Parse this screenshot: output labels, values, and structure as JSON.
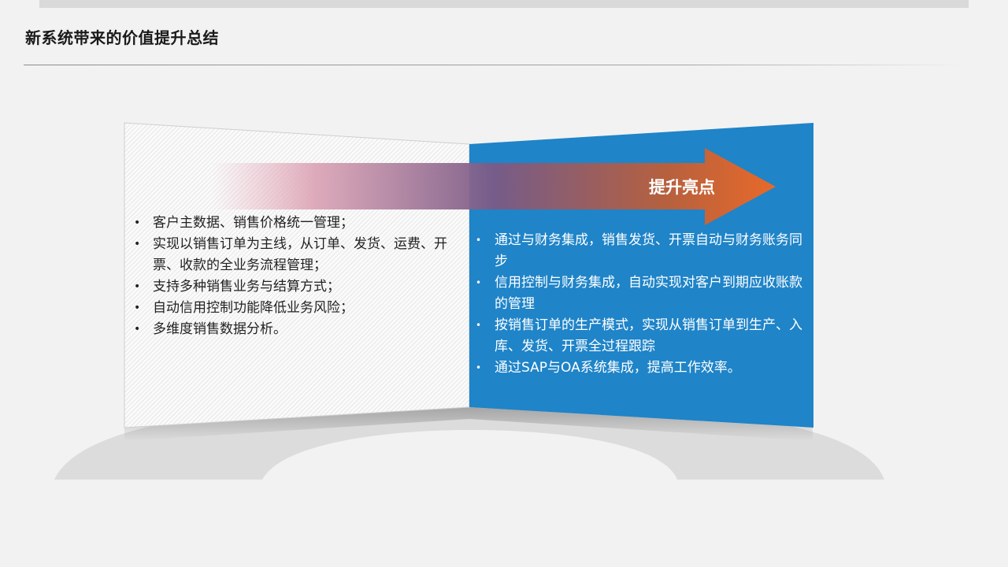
{
  "page": {
    "title": "新系统带来的价值提升总结"
  },
  "colors": {
    "panel_blue": "#1f84c8",
    "arrow_start": "#e8a8b8",
    "arrow_end": "#e8692a",
    "background": "#f2f2f2"
  },
  "arrow": {
    "label": "提升亮点"
  },
  "left_panel": {
    "items": [
      "客户主数据、销售价格统一管理；",
      "实现以销售订单为主线，从订单、发货、运费、开票、收款的全业务流程管理；",
      "支持多种销售业务与结算方式；",
      "自动信用控制功能降低业务风险；",
      "多维度销售数据分析。"
    ]
  },
  "right_panel": {
    "items": [
      "通过与财务集成，销售发货、开票自动与财务账务同步",
      "信用控制与财务集成，自动实现对客户到期应收账款的管理",
      "按销售订单的生产模式，实现从销售订单到生产、入库、发货、开票全过程跟踪",
      "通过SAP与OA系统集成，提高工作效率。"
    ]
  }
}
